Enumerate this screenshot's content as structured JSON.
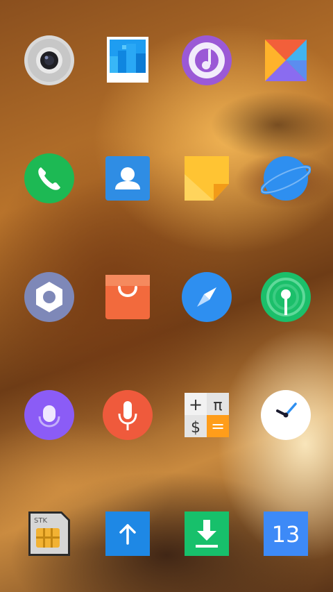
{
  "wallpaper": "lion",
  "apps": [
    {
      "row": 1,
      "col": 1,
      "icon": "camera-icon"
    },
    {
      "row": 1,
      "col": 2,
      "icon": "gallery-icon"
    },
    {
      "row": 1,
      "col": 3,
      "icon": "music-icon"
    },
    {
      "row": 1,
      "col": 4,
      "icon": "themes-icon"
    },
    {
      "row": 2,
      "col": 1,
      "icon": "phone-icon"
    },
    {
      "row": 2,
      "col": 2,
      "icon": "contacts-icon"
    },
    {
      "row": 2,
      "col": 3,
      "icon": "notes-icon"
    },
    {
      "row": 2,
      "col": 4,
      "icon": "browser-icon"
    },
    {
      "row": 3,
      "col": 1,
      "icon": "settings-icon"
    },
    {
      "row": 3,
      "col": 2,
      "icon": "store-icon"
    },
    {
      "row": 3,
      "col": 3,
      "icon": "compass-icon"
    },
    {
      "row": 3,
      "col": 4,
      "icon": "location-icon"
    },
    {
      "row": 4,
      "col": 1,
      "icon": "voice-assistant-icon"
    },
    {
      "row": 4,
      "col": 2,
      "icon": "recorder-icon"
    },
    {
      "row": 4,
      "col": 3,
      "icon": "calculator-icon"
    },
    {
      "row": 4,
      "col": 4,
      "icon": "clock-icon"
    },
    {
      "row": 5,
      "col": 1,
      "icon": "sim-toolkit-icon"
    },
    {
      "row": 5,
      "col": 2,
      "icon": "updater-icon"
    },
    {
      "row": 5,
      "col": 3,
      "icon": "downloads-icon"
    },
    {
      "row": 5,
      "col": 4,
      "icon": "calendar-icon"
    }
  ],
  "labels": {
    "sim_toolkit": "STK",
    "calculator_plus": "+",
    "calculator_pi": "π",
    "calculator_dollar": "$",
    "calculator_equals": "=",
    "calendar_date": "13"
  },
  "colors": {
    "phone": "#1db954",
    "contacts": "#2f8de4",
    "store": "#f26a3d",
    "compass": "#2e8ff0",
    "location": "#1bbf6a",
    "voice": "#8b5cf6",
    "recorder": "#ef5a3c",
    "updater": "#1e88e5",
    "downloads": "#17c06b",
    "calendar": "#3d8af7"
  }
}
